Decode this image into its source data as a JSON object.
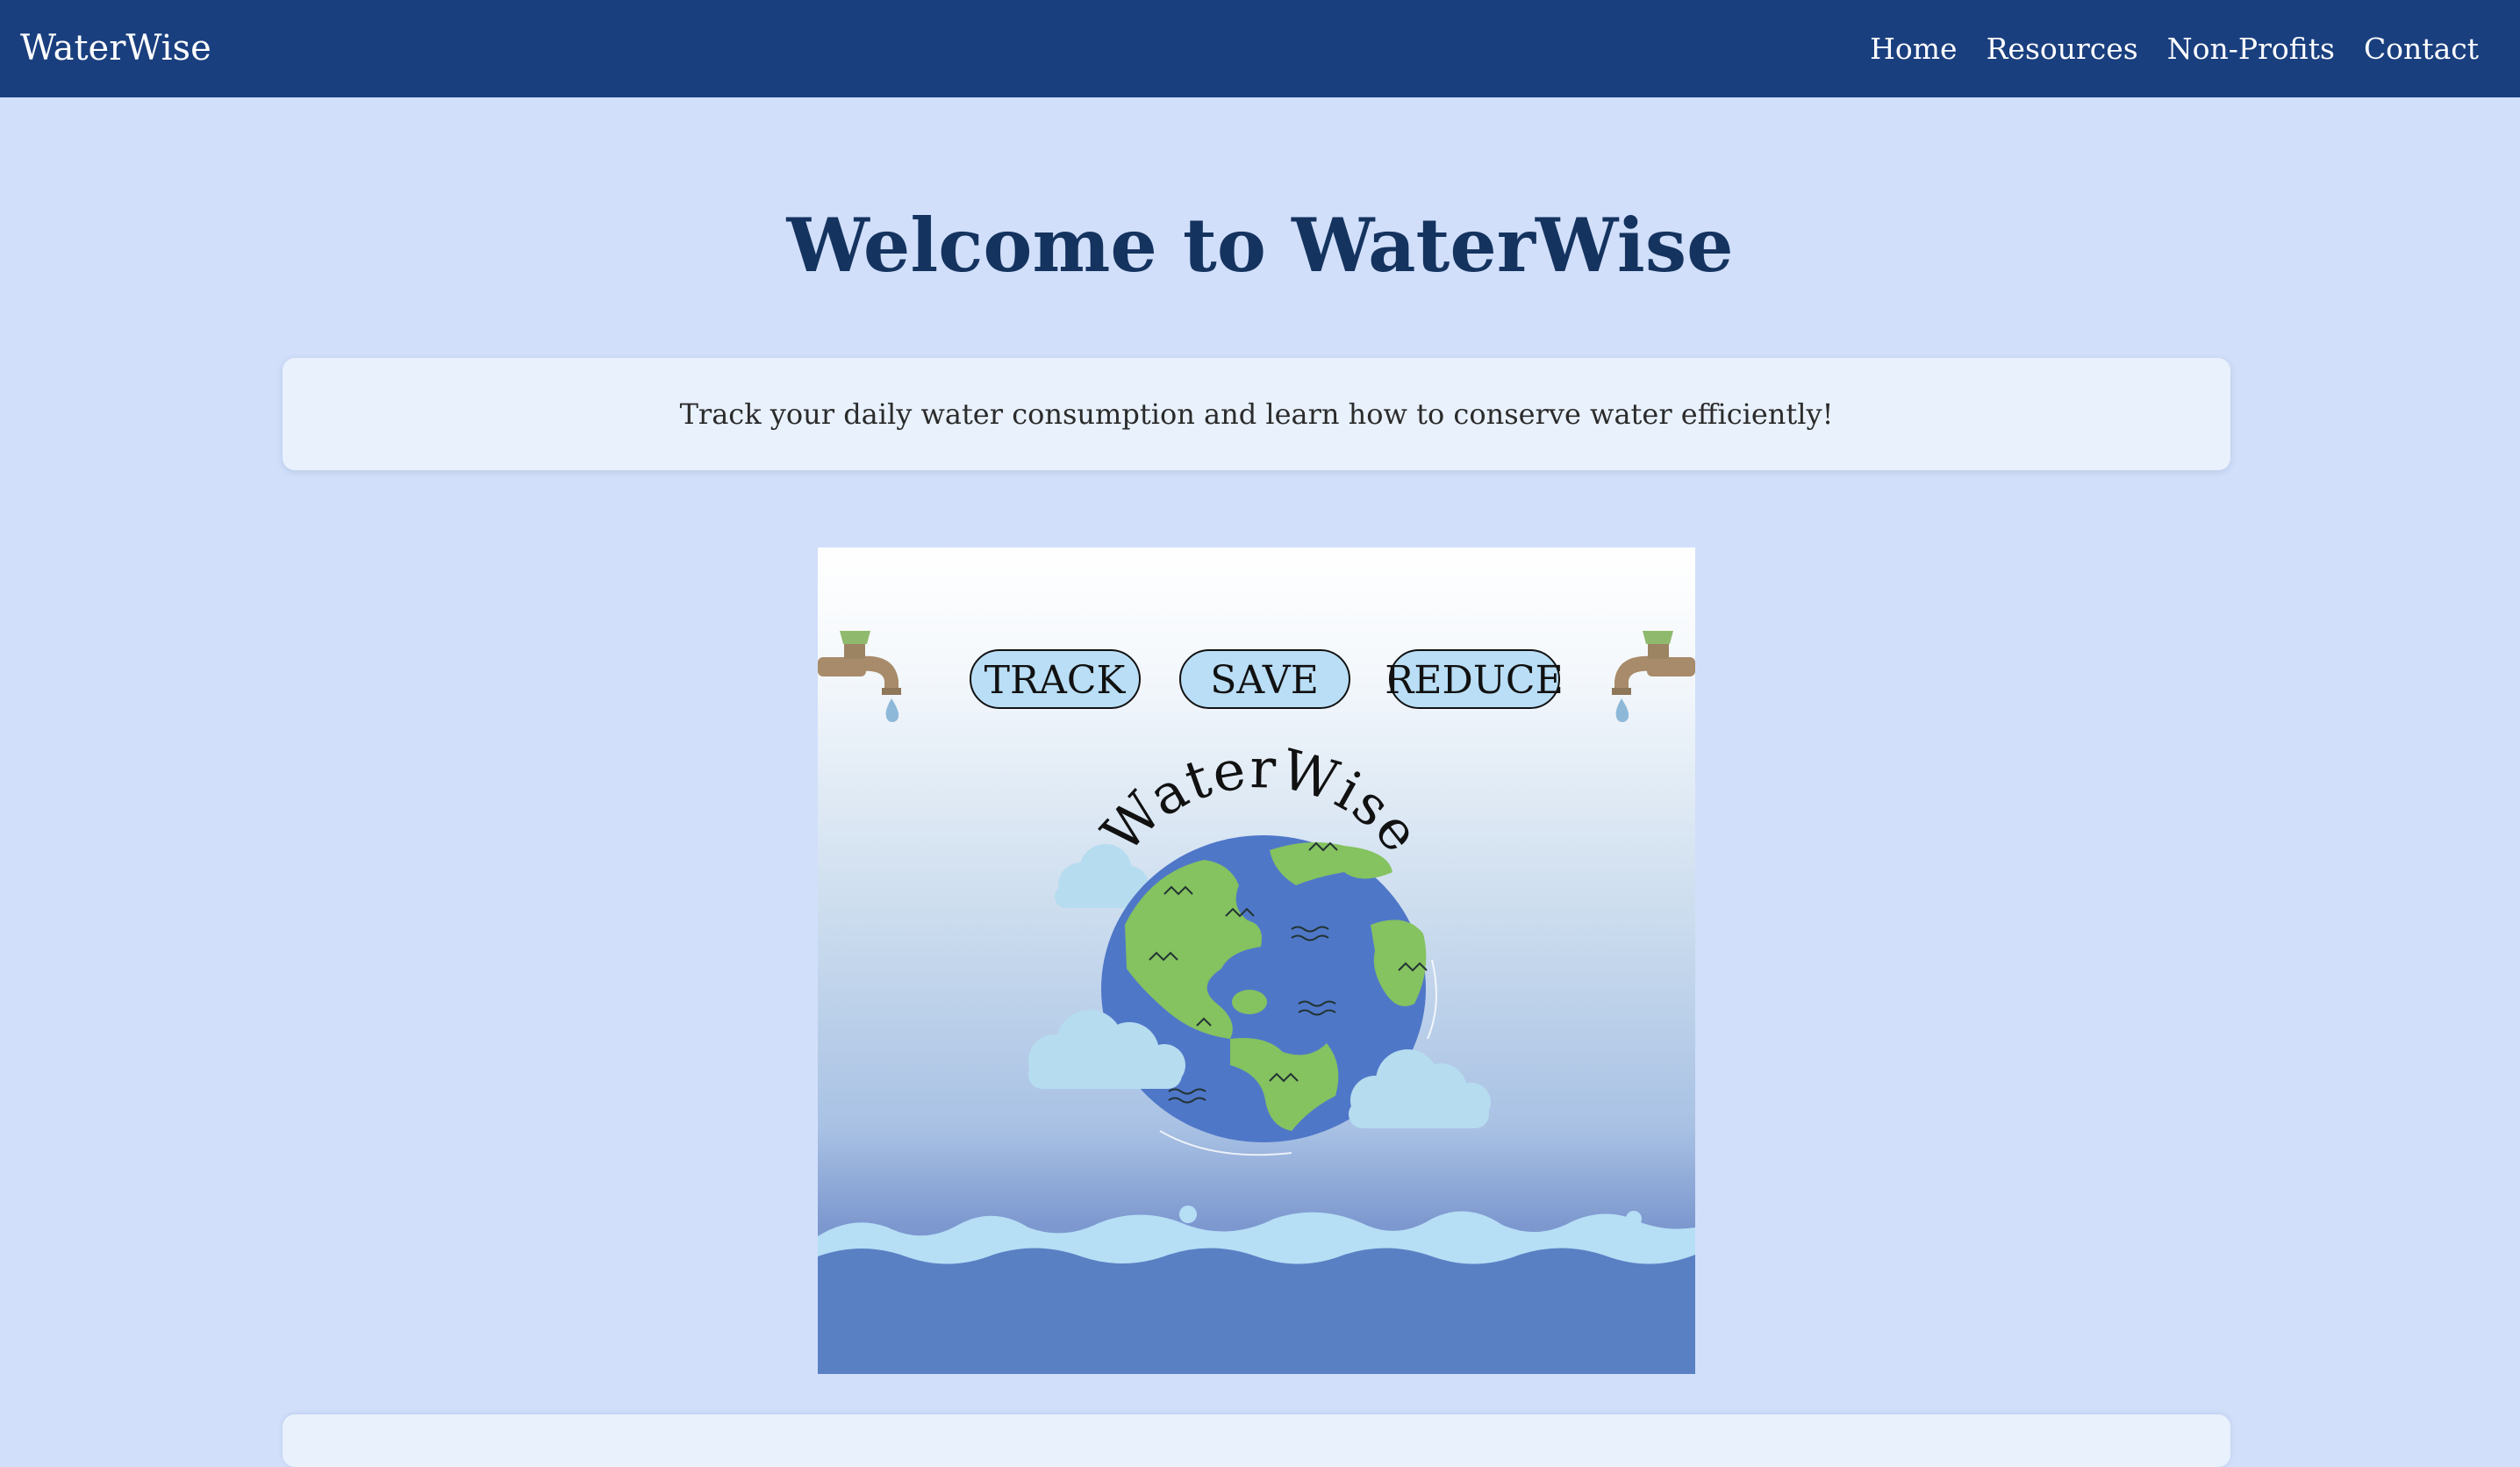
{
  "navbar": {
    "brand": "WaterWise",
    "links": [
      "Home",
      "Resources",
      "Non-Profits",
      "Contact"
    ]
  },
  "main": {
    "title": "Welcome to WaterWise",
    "intro": "Track your daily water consumption and learn how to conserve water efficiently!"
  },
  "hero_image": {
    "pills": [
      "TRACK",
      "SAVE",
      "REDUCE"
    ],
    "logo_text": "WaterWise"
  },
  "colors": {
    "nav_bg": "#1a3f7f",
    "page_bg": "#d1dffa",
    "title": "#15335f",
    "card_bg": "#e8f1fc",
    "pill_fill": "#b9def6",
    "water": "#5a80c4",
    "wave": "#b6def5",
    "land": "#85c260",
    "ocean": "#4f77c8"
  }
}
